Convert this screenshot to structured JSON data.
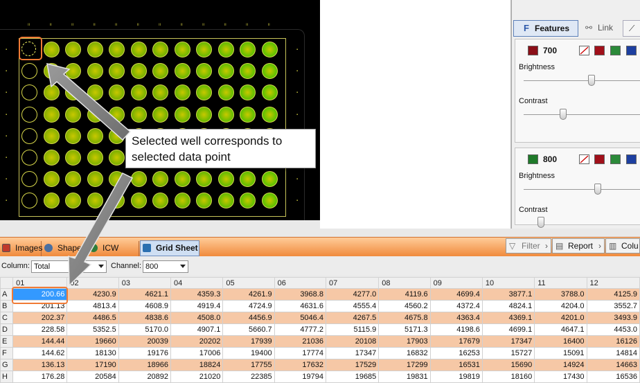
{
  "plate": {
    "selected_well": "A01",
    "well_color": "#b8b800",
    "frame_color": "#d8d84a"
  },
  "callout": {
    "line1": "Selected well corresponds to",
    "line2": "selected data point"
  },
  "right_panel": {
    "tabs": [
      {
        "label": "Features",
        "icon": "features-icon"
      },
      {
        "label": "Link",
        "icon": "link-icon"
      }
    ],
    "channels": [
      {
        "name": "700",
        "brightness_label": "Brightness",
        "contrast_label": "Contrast",
        "brightness_level": 0.52,
        "contrast_level": 0.34,
        "color": "#8b0f18"
      },
      {
        "name": "800",
        "brightness_label": "Brightness",
        "contrast_label": "Contrast",
        "brightness_level": 0.56,
        "contrast_level": 0.1,
        "color": "#1f7a2a"
      }
    ]
  },
  "bottom_tabs": [
    {
      "label": "Images",
      "icon": "images-icon"
    },
    {
      "label": "Shapes",
      "icon": "shapes-icon"
    },
    {
      "label": "ICW Wells",
      "icon": "icw-wells-icon"
    },
    {
      "label": "Grid Sheet",
      "icon": "grid-sheet-icon",
      "active": true
    }
  ],
  "right_buttons": [
    {
      "label": "Filter",
      "icon": "filter-icon"
    },
    {
      "label": "Report",
      "icon": "report-icon"
    },
    {
      "label": "Colu",
      "icon": "columns-icon"
    }
  ],
  "toolbar": {
    "column_label": "Column:",
    "column_value": "Total",
    "channel_label": "Channel:",
    "channel_value": "800"
  },
  "grid": {
    "columns": [
      "01",
      "02",
      "03",
      "04",
      "05",
      "06",
      "07",
      "08",
      "09",
      "10",
      "11",
      "12"
    ],
    "rows": [
      {
        "label": "A",
        "values": [
          "200.66",
          "4230.9",
          "4621.1",
          "4359.3",
          "4261.9",
          "3968.8",
          "4277.0",
          "4119.6",
          "4699.4",
          "3877.1",
          "3788.0",
          "4125.9"
        ]
      },
      {
        "label": "B",
        "values": [
          "201.13",
          "4813.4",
          "4608.9",
          "4919.4",
          "4724.9",
          "4631.6",
          "4555.4",
          "4560.2",
          "4372.4",
          "4824.1",
          "4204.0",
          "3552.7"
        ]
      },
      {
        "label": "C",
        "values": [
          "202.37",
          "4486.5",
          "4838.6",
          "4508.0",
          "4456.9",
          "5046.4",
          "4267.5",
          "4675.8",
          "4363.4",
          "4369.1",
          "4201.0",
          "3493.9"
        ]
      },
      {
        "label": "D",
        "values": [
          "228.58",
          "5352.5",
          "5170.0",
          "4907.1",
          "5660.7",
          "4777.2",
          "5115.9",
          "5171.3",
          "4198.6",
          "4699.1",
          "4647.1",
          "4453.0"
        ]
      },
      {
        "label": "E",
        "values": [
          "144.44",
          "19660",
          "20039",
          "20202",
          "17939",
          "21036",
          "20108",
          "17903",
          "17679",
          "17347",
          "16400",
          "16126"
        ]
      },
      {
        "label": "F",
        "values": [
          "144.62",
          "18130",
          "19176",
          "17006",
          "19400",
          "17774",
          "17347",
          "16832",
          "16253",
          "15727",
          "15091",
          "14814"
        ]
      },
      {
        "label": "G",
        "values": [
          "136.13",
          "17190",
          "18966",
          "18824",
          "17755",
          "17632",
          "17529",
          "17299",
          "16531",
          "15690",
          "14924",
          "14663"
        ]
      },
      {
        "label": "H",
        "values": [
          "176.28",
          "20584",
          "20892",
          "21020",
          "22385",
          "19794",
          "19685",
          "19831",
          "19819",
          "18160",
          "17430",
          "16536"
        ]
      }
    ]
  }
}
